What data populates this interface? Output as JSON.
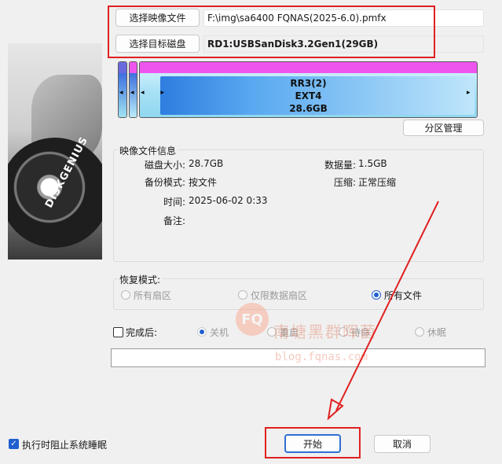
{
  "toolbar": {
    "select_image_label": "选择映像文件",
    "image_path": "F:\\img\\sa6400 FQNAS(2025-6.0).pmfx",
    "select_target_label": "选择目标磁盘",
    "target_disk": "RD1:USBSanDisk3.2Gen1(29GB)"
  },
  "partition": {
    "name": "RR3(2)",
    "fs": "EXT4",
    "size": "28.6GB",
    "manage_label": "分区管理",
    "cap_color": "#ee55ee"
  },
  "image_info": {
    "title": "映像文件信息",
    "disk_size_label": "磁盘大小:",
    "disk_size_value": "28.7GB",
    "data_size_label": "数据量:",
    "data_size_value": "1.5GB",
    "backup_mode_label": "备份模式:",
    "backup_mode_value": "按文件",
    "compress_label": "压缩:",
    "compress_value": "正常压缩",
    "time_label": "时间:",
    "time_value": "2025-06-02 0:33",
    "note_label": "备注:"
  },
  "restore_mode": {
    "title": "恢复模式:",
    "options": [
      "所有扇区",
      "仅限数据扇区",
      "所有文件"
    ],
    "selected": "所有文件"
  },
  "after_complete": {
    "label": "完成后:",
    "options": [
      "关机",
      "重启",
      "待命",
      "休眠"
    ],
    "selected": "关机"
  },
  "prevent_sleep_label": "执行时阻止系统睡眠",
  "actions": {
    "start_label": "开始",
    "cancel_label": "取消"
  },
  "disk_art_brand": "DISKGENIUS",
  "watermark": {
    "logo_text": "FQ",
    "text": "南塘黑群晖菌",
    "url": "blog.fqnas.com"
  },
  "colors": {
    "accent": "#1f5fd0",
    "annotation_red": "#e02020"
  }
}
